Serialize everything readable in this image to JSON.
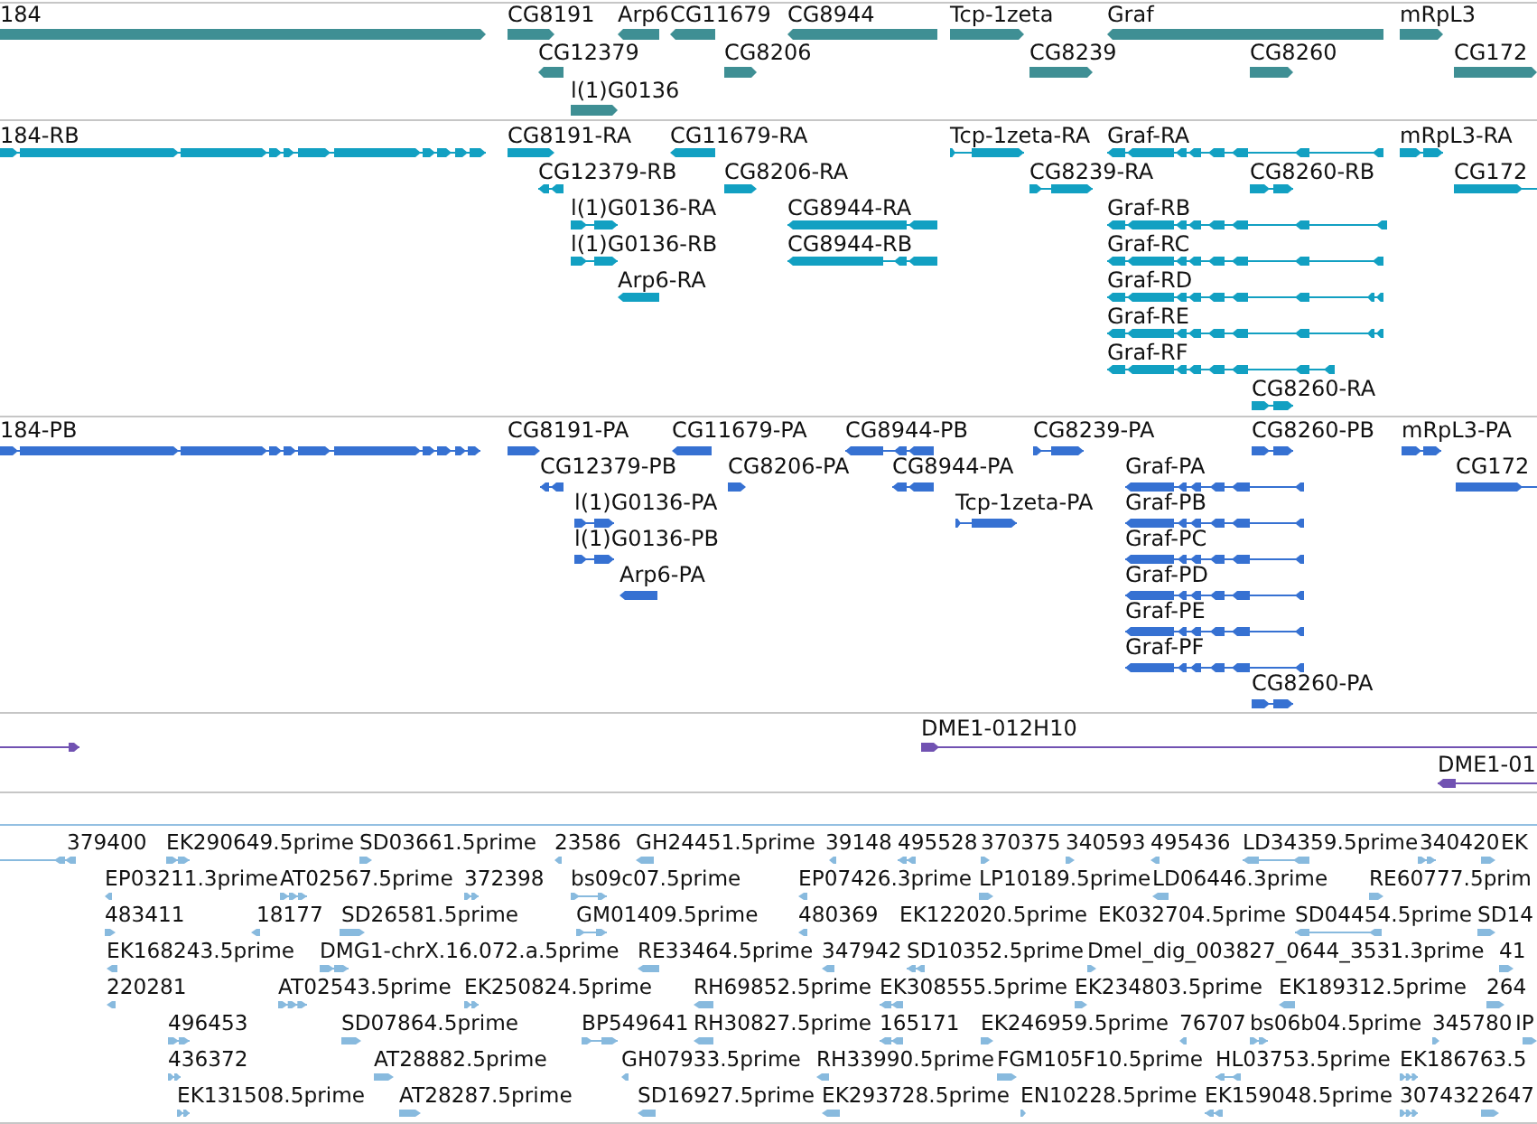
{
  "tracks": [
    {
      "kind": "gene",
      "color": "#3f8f94",
      "features": [
        {
          "label": "184",
          "reverse": false
        },
        {
          "label": "CG8191",
          "reverse": false
        },
        {
          "label": "Arp6",
          "reverse": true
        },
        {
          "label": "CG11679",
          "reverse": true
        },
        {
          "label": "CG8944",
          "reverse": true
        },
        {
          "label": "Tcp-1zeta",
          "reverse": false
        },
        {
          "label": "Graf",
          "reverse": true
        },
        {
          "label": "mRpL3",
          "reverse": false
        },
        {
          "label": "CG12379",
          "reverse": true
        },
        {
          "label": "CG8206",
          "reverse": false
        },
        {
          "label": "CG8239",
          "reverse": false
        },
        {
          "label": "CG8260",
          "reverse": false
        },
        {
          "label": "CG172",
          "reverse": false
        },
        {
          "label": "l(1)G0136",
          "reverse": false
        }
      ]
    },
    {
      "kind": "transcript",
      "color": "#12a0c2",
      "features": [
        {
          "label": "184-RB",
          "reverse": false
        },
        {
          "label": "CG8191-RA",
          "reverse": false
        },
        {
          "label": "CG11679-RA",
          "reverse": true
        },
        {
          "label": "Tcp-1zeta-RA",
          "reverse": false
        },
        {
          "label": "Graf-RA",
          "reverse": true
        },
        {
          "label": "mRpL3-RA",
          "reverse": false
        },
        {
          "label": "CG12379-RB",
          "reverse": true
        },
        {
          "label": "CG8206-RA",
          "reverse": false
        },
        {
          "label": "CG8239-RA",
          "reverse": false
        },
        {
          "label": "CG8260-RB",
          "reverse": false
        },
        {
          "label": "CG172",
          "reverse": false
        },
        {
          "label": "l(1)G0136-RA",
          "reverse": false
        },
        {
          "label": "CG8944-RA",
          "reverse": true
        },
        {
          "label": "Graf-RB",
          "reverse": true
        },
        {
          "label": "l(1)G0136-RB",
          "reverse": false
        },
        {
          "label": "CG8944-RB",
          "reverse": true
        },
        {
          "label": "Graf-RC",
          "reverse": true
        },
        {
          "label": "Arp6-RA",
          "reverse": true
        },
        {
          "label": "Graf-RD",
          "reverse": true
        },
        {
          "label": "Graf-RE",
          "reverse": true
        },
        {
          "label": "Graf-RF",
          "reverse": true
        },
        {
          "label": "CG8260-RA",
          "reverse": false
        }
      ]
    },
    {
      "kind": "protein",
      "color": "#3671d2",
      "features": [
        {
          "label": "184-PB",
          "reverse": false
        },
        {
          "label": "CG8191-PA",
          "reverse": false
        },
        {
          "label": "CG11679-PA",
          "reverse": true
        },
        {
          "label": "CG8944-PB",
          "reverse": true
        },
        {
          "label": "CG8239-PA",
          "reverse": false
        },
        {
          "label": "CG8260-PB",
          "reverse": false
        },
        {
          "label": "mRpL3-PA",
          "reverse": false
        },
        {
          "label": "CG12379-PB",
          "reverse": true
        },
        {
          "label": "CG8206-PA",
          "reverse": false
        },
        {
          "label": "CG8944-PA",
          "reverse": true
        },
        {
          "label": "Graf-PA",
          "reverse": true
        },
        {
          "label": "CG172",
          "reverse": false
        },
        {
          "label": "l(1)G0136-PA",
          "reverse": false
        },
        {
          "label": "Tcp-1zeta-PA",
          "reverse": false
        },
        {
          "label": "Graf-PB",
          "reverse": true
        },
        {
          "label": "l(1)G0136-PB",
          "reverse": false
        },
        {
          "label": "Graf-PC",
          "reverse": true
        },
        {
          "label": "Arp6-PA",
          "reverse": true
        },
        {
          "label": "Graf-PD",
          "reverse": true
        },
        {
          "label": "Graf-PE",
          "reverse": true
        },
        {
          "label": "Graf-PF",
          "reverse": true
        },
        {
          "label": "CG8260-PA",
          "reverse": false
        }
      ]
    },
    {
      "kind": "clone",
      "color": "#7152b2",
      "features": [
        {
          "reverse": false
        },
        {
          "label": "DME1-012H10",
          "reverse": false
        },
        {
          "label": "DME1-01",
          "reverse": true
        }
      ]
    },
    {
      "kind": "est",
      "color": "#88bade",
      "features": [
        {
          "label": "379400",
          "reverse": true
        },
        {
          "label": "EK290649.5prime",
          "reverse": false
        },
        {
          "label": "SD03661.5prime",
          "reverse": false
        },
        {
          "label": "23586",
          "reverse": true
        },
        {
          "label": "GH24451.5prime",
          "reverse": true
        },
        {
          "label": "39148",
          "reverse": true
        },
        {
          "label": "495528",
          "reverse": true
        },
        {
          "label": "370375",
          "reverse": false
        },
        {
          "label": "340593",
          "reverse": false
        },
        {
          "label": "495436",
          "reverse": true
        },
        {
          "label": "LD34359.5prime",
          "reverse": true
        },
        {
          "label": "340420",
          "reverse": false
        },
        {
          "label": "EK",
          "reverse": false
        },
        {
          "label": "EP03211.3prime",
          "reverse": true
        },
        {
          "label": "AT02567.5prime",
          "reverse": false
        },
        {
          "label": "372398",
          "reverse": false
        },
        {
          "label": "bs09c07.5prime",
          "reverse": false
        },
        {
          "label": "EP07426.3prime",
          "reverse": true
        },
        {
          "label": "LP10189.5prime",
          "reverse": false
        },
        {
          "label": "LD06446.3prime",
          "reverse": true
        },
        {
          "label": "RE60777.5prim",
          "reverse": false
        },
        {
          "label": "483411",
          "reverse": false
        },
        {
          "label": "18177",
          "reverse": true
        },
        {
          "label": "SD26581.5prime",
          "reverse": false
        },
        {
          "label": "GM01409.5prime",
          "reverse": false
        },
        {
          "label": "480369",
          "reverse": true
        },
        {
          "label": "EK122020.5prime"
        },
        {
          "label": "EK032704.5prime"
        },
        {
          "label": "SD04454.5prime",
          "reverse": true
        },
        {
          "label": "SD14",
          "reverse": false
        },
        {
          "label": "EK168243.5prime",
          "reverse": true
        },
        {
          "label": "DMG1-chrX.16.072.a.5prime",
          "reverse": false
        },
        {
          "label": "RE33464.5prime",
          "reverse": true
        },
        {
          "label": "347942",
          "reverse": true
        },
        {
          "label": "SD10352.5prime",
          "reverse": true
        },
        {
          "label": "Dmel_dig_003827_0644_3531.3prime",
          "reverse": false
        },
        {
          "label": "41",
          "reverse": false
        },
        {
          "label": "220281",
          "reverse": true
        },
        {
          "label": "AT02543.5prime",
          "reverse": false
        },
        {
          "label": "EK250824.5prime",
          "reverse": false
        },
        {
          "label": "RH69852.5prime",
          "reverse": true
        },
        {
          "label": "EK308555.5prime",
          "reverse": true
        },
        {
          "label": "EK234803.5prime",
          "reverse": false
        },
        {
          "label": "EK189312.5prime",
          "reverse": true
        },
        {
          "label": "264",
          "reverse": false
        },
        {
          "label": "496453",
          "reverse": false
        },
        {
          "label": "SD07864.5prime",
          "reverse": false
        },
        {
          "label": "BP549641",
          "reverse": false
        },
        {
          "label": "RH30827.5prime",
          "reverse": true
        },
        {
          "label": "165171",
          "reverse": true
        },
        {
          "label": "EK246959.5prime",
          "reverse": false
        },
        {
          "label": "76707",
          "reverse": true
        },
        {
          "label": "bs06b04.5prime",
          "reverse": false
        },
        {
          "label": "345780",
          "reverse": false
        },
        {
          "label": "IP",
          "reverse": false
        },
        {
          "label": "436372",
          "reverse": false
        },
        {
          "label": "AT28882.5prime",
          "reverse": false
        },
        {
          "label": "GH07933.5prime",
          "reverse": true
        },
        {
          "label": "RH33990.5prime",
          "reverse": true
        },
        {
          "label": "FGM105F10.5prime",
          "reverse": false
        },
        {
          "label": "HL03753.5prime",
          "reverse": true
        },
        {
          "label": "EK186763.5",
          "reverse": false
        },
        {
          "label": "EK131508.5prime",
          "reverse": false
        },
        {
          "label": "AT28287.5prime",
          "reverse": false
        },
        {
          "label": "SD16927.5prime",
          "reverse": true
        },
        {
          "label": "EK293728.5prime",
          "reverse": true
        },
        {
          "label": "EN10228.5prime",
          "reverse": false
        },
        {
          "label": "EK159048.5prime",
          "reverse": true
        },
        {
          "label": "307432",
          "reverse": false
        },
        {
          "label": "2647",
          "reverse": false
        }
      ]
    }
  ]
}
